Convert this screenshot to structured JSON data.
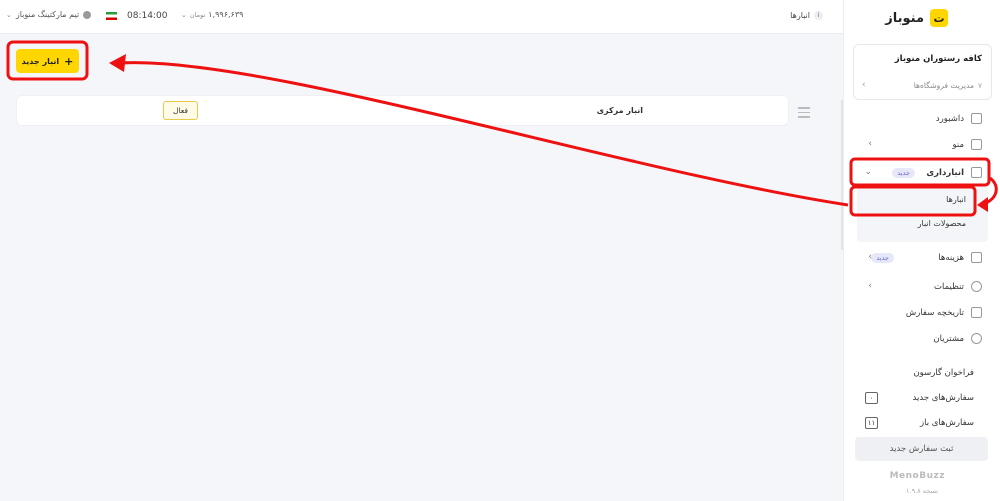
{
  "brand": {
    "name": "منوباز",
    "logo_letter": "ت",
    "footer": "MenoBuzz",
    "version": "نسخه ۱.۹.۸"
  },
  "store": {
    "name": "کافه رستوران منوباز",
    "manage_label": "مدیریت فروشگاه‌ها",
    "count": "۷"
  },
  "sidebar": {
    "dashboard": "داشبورد",
    "menu": "منو",
    "inventory": "انبارداری",
    "inventory_badge": "جدید",
    "inventory_sub": {
      "warehouses": "انبارها",
      "products": "محصولات انبار"
    },
    "costs": "هزینه‌ها",
    "costs_badge": "جدید",
    "settings": "تنظیمات",
    "order_history": "تاریخچه سفارش",
    "customers": "مشتریان"
  },
  "waiter": {
    "title": "فراخوان گارسون",
    "new_orders": "سفارش‌های جدید",
    "new_orders_count": "۰",
    "open_orders": "سفارش‌های باز",
    "open_orders_count": "۱۱",
    "submit_order": "ثبت سفارش جدید"
  },
  "header": {
    "page": "انبارها",
    "info": "i",
    "balance": "۱,۹۹۶,۶۳۹",
    "balance_unit": "تومان",
    "time": "08:14:00",
    "user": "تیم مارکتینگ منوباز"
  },
  "main": {
    "new_button": "انبار جدید",
    "warehouse_name": "انبار مرکزی",
    "status": "فعال"
  },
  "colors": {
    "accent": "#ffd600",
    "annotation": "#ee1111",
    "badge_bg": "#e6e7f8"
  }
}
